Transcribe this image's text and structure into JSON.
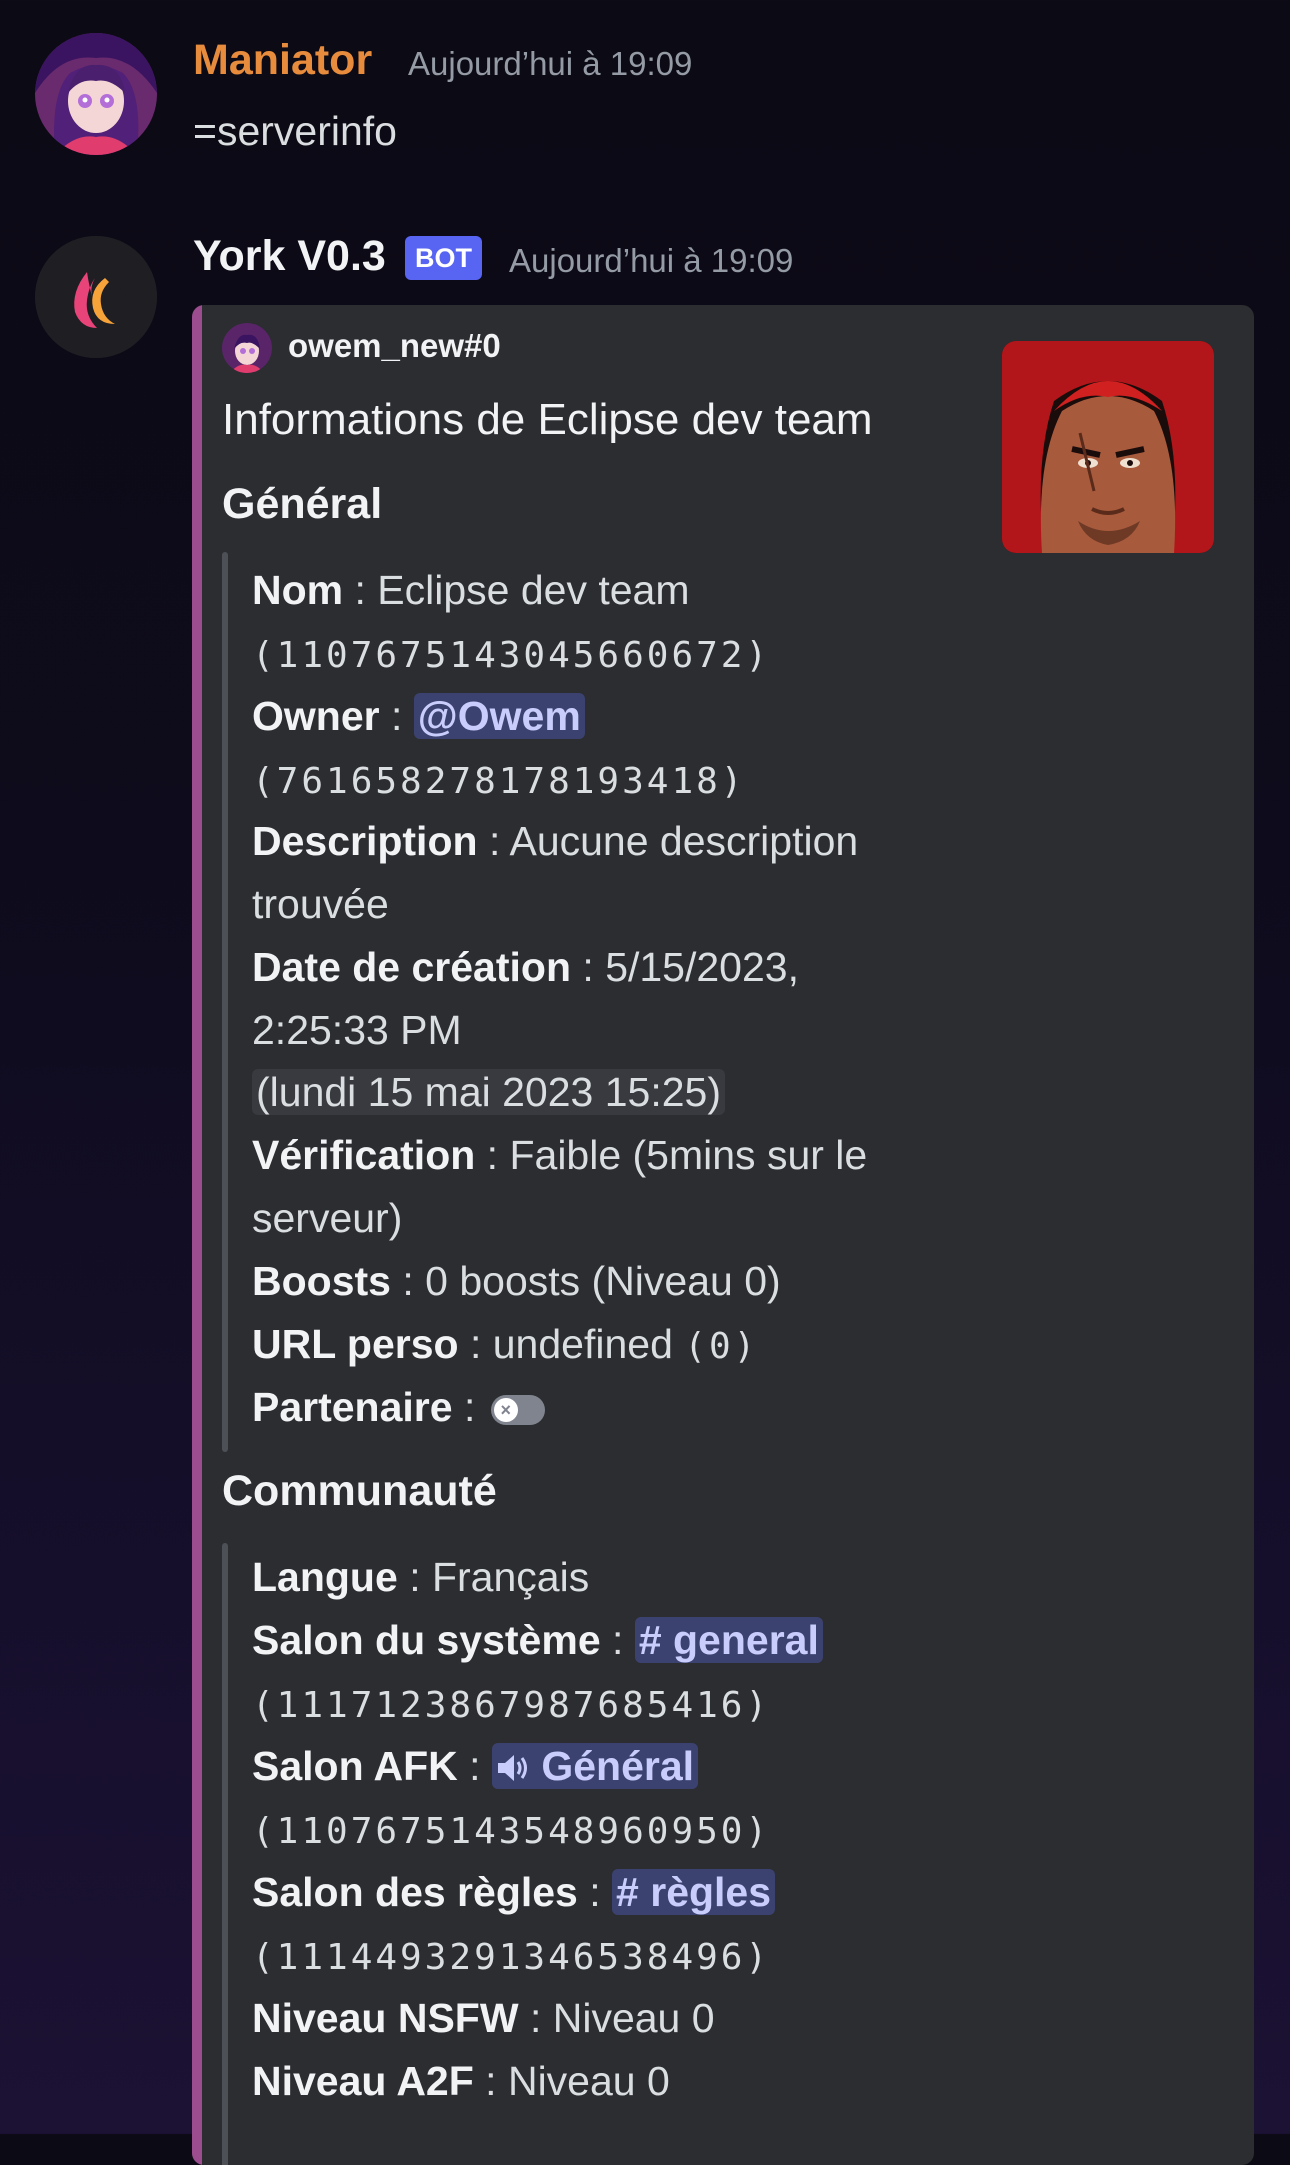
{
  "messages": [
    {
      "username": "Maniator",
      "username_color": "#e78b3c",
      "timestamp": "Aujourd’hui à 19:09",
      "content": "=serverinfo"
    },
    {
      "username": "York V0.3",
      "username_color": "#f2f3f5",
      "badge": "BOT",
      "timestamp": "Aujourd’hui à 19:09"
    }
  ],
  "embed": {
    "author": "owem_new#0",
    "title": "Informations de Eclipse dev team",
    "accent_color": "#9b4d8f",
    "general": {
      "title": "Général",
      "nom_label": "Nom",
      "nom_value": "Eclipse dev team",
      "nom_id": "(1107675143045660672)",
      "owner_label": "Owner",
      "owner_mention": "@Owem",
      "owner_id": "(761658278178193418)",
      "description_label": "Description",
      "description_value_1": "Aucune description",
      "description_value_2": "trouvée",
      "date_label": "Date de création",
      "date_value_1": "5/15/2023,",
      "date_value_2": "2:25:33 PM",
      "date_formatted": "(lundi 15 mai 2023 15:25)",
      "verification_label": "Vérification",
      "verification_value_1": "Faible (5mins sur le",
      "verification_value_2": "serveur)",
      "boosts_label": "Boosts",
      "boosts_value": "0 boosts (Niveau 0)",
      "url_label": "URL perso",
      "url_value": "undefined",
      "url_code": "(0)",
      "partner_label": "Partenaire",
      "partner_toggle": "off"
    },
    "community": {
      "title": "Communauté",
      "langue_label": "Langue",
      "langue_value": "Français",
      "system_label": "Salon du système",
      "system_channel": "# general",
      "system_id": "(1117123867987685416)",
      "afk_label": "Salon AFK",
      "afk_channel": "Général",
      "afk_id": "(1107675143548960950)",
      "rules_label": "Salon des règles",
      "rules_channel": "# règles",
      "rules_id": "(1114493291346538496)",
      "nsfw_label": "Niveau NSFW",
      "nsfw_value": "Niveau 0",
      "a2f_label": "Niveau A2F",
      "a2f_value": "Niveau 0"
    }
  },
  "icons": {
    "speaker": "speaker-icon",
    "toggle_off": "toggle-off-icon"
  },
  "colors": {
    "mention_bg": "#3c4270",
    "mention_text": "#c9cdfb",
    "bot_badge": "#5865f2"
  }
}
